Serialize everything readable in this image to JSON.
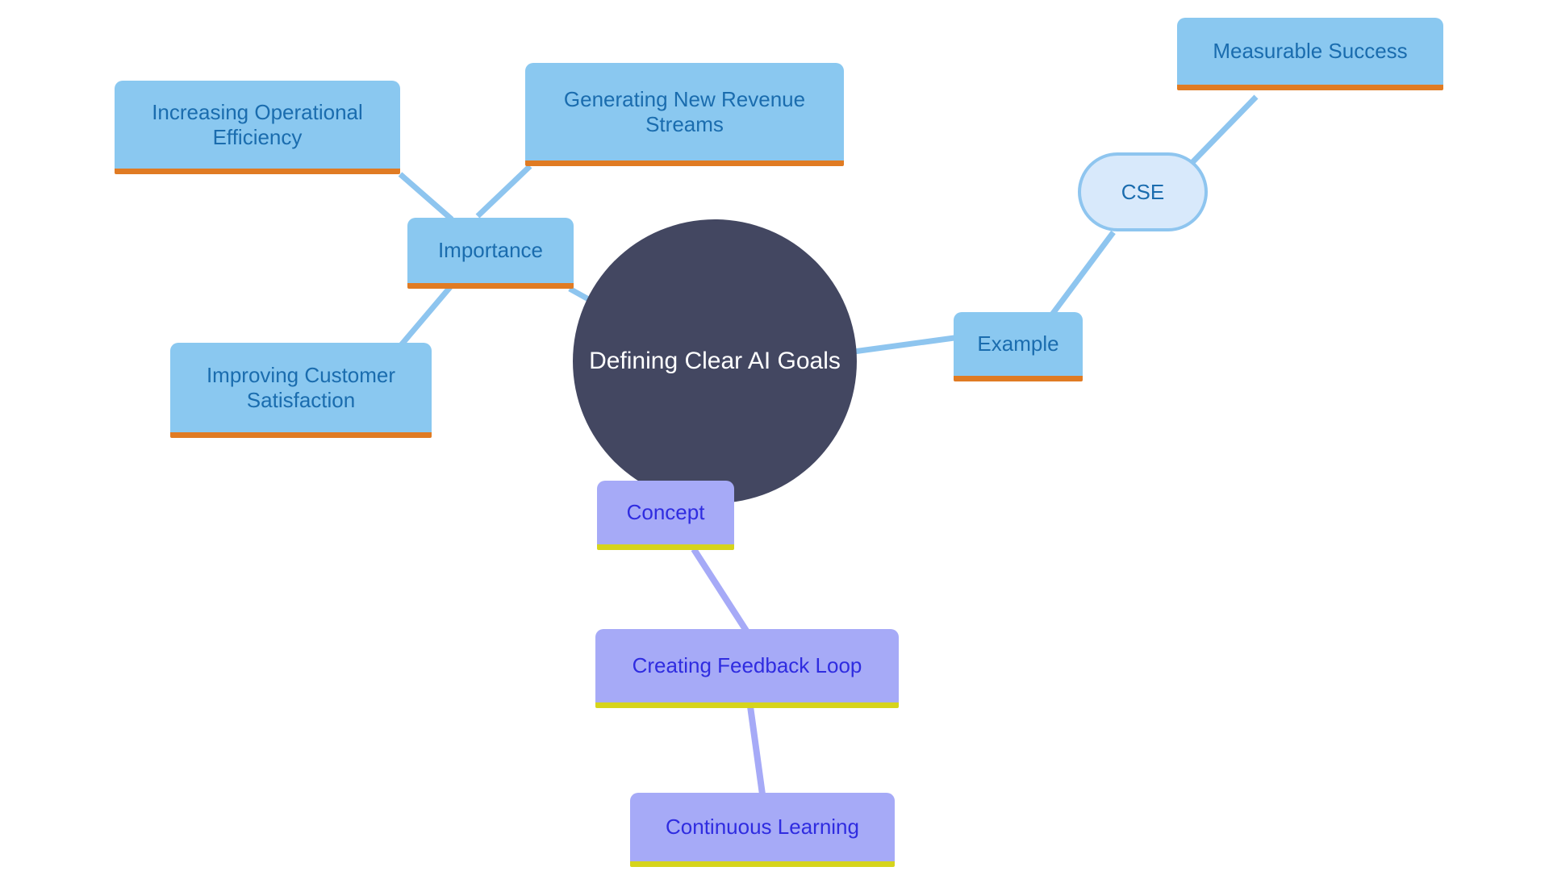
{
  "diagram": {
    "type": "mind-map",
    "title": "Defining Clear AI Goals",
    "background_color": "#ffffff",
    "palette": {
      "center_fill": "#434761",
      "center_text": "#ffffff",
      "blue_fill": "#8ac8f0",
      "blue_text": "#1a6cae",
      "blue_accent": "#e07b23",
      "purple_fill": "#a6aaf7",
      "purple_text": "#2f2ce0",
      "purple_accent": "#d6d41c",
      "pill_fill": "#d8e9fb",
      "pill_border": "#8ec5ef",
      "edge_blue": "#8ec5ef",
      "edge_purple": "#a6aaf7"
    },
    "center": {
      "label": "Defining Clear AI Goals"
    },
    "nodes": [
      {
        "id": "importance",
        "label": "Importance",
        "group": "blue",
        "shape": "rect"
      },
      {
        "id": "increasing-efficiency",
        "label": "Increasing Operational Efficiency",
        "group": "blue",
        "shape": "rect"
      },
      {
        "id": "revenue-streams",
        "label": "Generating New Revenue Streams",
        "group": "blue",
        "shape": "rect"
      },
      {
        "id": "customer-satisfaction",
        "label": "Improving Customer Satisfaction",
        "group": "blue",
        "shape": "rect"
      },
      {
        "id": "example",
        "label": "Example",
        "group": "blue",
        "shape": "rect"
      },
      {
        "id": "cse",
        "label": "CSE",
        "group": "pill",
        "shape": "pill"
      },
      {
        "id": "measurable-success",
        "label": "Measurable Success",
        "group": "blue",
        "shape": "rect"
      },
      {
        "id": "concept",
        "label": "Concept",
        "group": "purple",
        "shape": "rect"
      },
      {
        "id": "feedback-loop",
        "label": "Creating Feedback Loop",
        "group": "purple",
        "shape": "rect"
      },
      {
        "id": "continuous-learning",
        "label": "Continuous Learning",
        "group": "purple",
        "shape": "rect"
      }
    ],
    "edges": [
      {
        "from": "center",
        "to": "importance",
        "color": "#8ec5ef"
      },
      {
        "from": "importance",
        "to": "increasing-efficiency",
        "color": "#8ec5ef"
      },
      {
        "from": "importance",
        "to": "revenue-streams",
        "color": "#8ec5ef"
      },
      {
        "from": "importance",
        "to": "customer-satisfaction",
        "color": "#8ec5ef"
      },
      {
        "from": "center",
        "to": "example",
        "color": "#8ec5ef"
      },
      {
        "from": "example",
        "to": "cse",
        "color": "#8ec5ef"
      },
      {
        "from": "cse",
        "to": "measurable-success",
        "color": "#8ec5ef"
      },
      {
        "from": "center",
        "to": "concept",
        "color": "#a6aaf7"
      },
      {
        "from": "concept",
        "to": "feedback-loop",
        "color": "#a6aaf7"
      },
      {
        "from": "feedback-loop",
        "to": "continuous-learning",
        "color": "#a6aaf7"
      }
    ]
  }
}
